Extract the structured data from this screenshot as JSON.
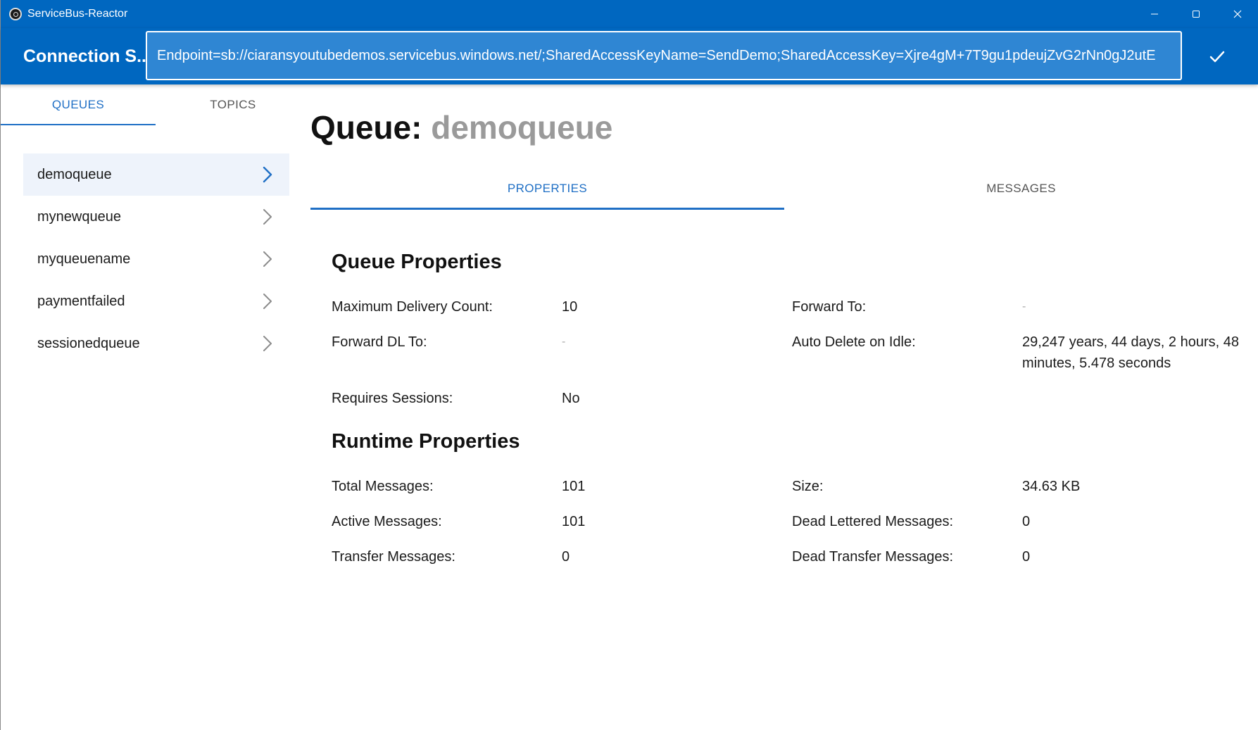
{
  "window": {
    "title": "ServiceBus-Reactor"
  },
  "header": {
    "label": "Connection S...",
    "connection_string": "Endpoint=sb://ciaransyoutubedemos.servicebus.windows.net/;SharedAccessKeyName=SendDemo;SharedAccessKey=Xjre4gM+7T9gu1pdeujZvG2rNn0gJ2utE"
  },
  "left_tabs": {
    "queues": "QUEUES",
    "topics": "TOPICS"
  },
  "queues": [
    {
      "name": "demoqueue",
      "selected": true
    },
    {
      "name": "mynewqueue",
      "selected": false
    },
    {
      "name": "myqueuename",
      "selected": false
    },
    {
      "name": "paymentfailed",
      "selected": false
    },
    {
      "name": "sessionedqueue",
      "selected": false
    }
  ],
  "main": {
    "title_prefix": "Queue:",
    "title_name": "demoqueue",
    "tabs": {
      "properties": "PROPERTIES",
      "messages": "MESSAGES"
    }
  },
  "queue_properties": {
    "heading": "Queue Properties",
    "max_delivery_label": "Maximum Delivery Count:",
    "max_delivery_value": "10",
    "forward_to_label": "Forward To:",
    "forward_to_value": "-",
    "forward_dl_label": "Forward DL To:",
    "forward_dl_value": "-",
    "auto_delete_label": "Auto Delete on Idle:",
    "auto_delete_value": "29,247 years, 44 days, 2 hours, 48 minutes, 5.478 seconds",
    "requires_sessions_label": "Requires Sessions:",
    "requires_sessions_value": "No"
  },
  "runtime_properties": {
    "heading": "Runtime Properties",
    "total_label": "Total Messages:",
    "total_value": "101",
    "size_label": "Size:",
    "size_value": "34.63 KB",
    "active_label": "Active Messages:",
    "active_value": "101",
    "dead_lettered_label": "Dead Lettered Messages:",
    "dead_lettered_value": "0",
    "transfer_label": "Transfer Messages:",
    "transfer_value": "0",
    "dead_transfer_label": "Dead Transfer Messages:",
    "dead_transfer_value": "0"
  },
  "colors": {
    "accent": "#0067c0",
    "tab_active": "#1f6fc5",
    "selected_row": "#eef3fb",
    "muted_title": "#9a9a9a"
  },
  "icons": [
    "app-icon",
    "minimize-icon",
    "maximize-icon",
    "close-icon",
    "check-icon",
    "chevron-right-icon"
  ]
}
